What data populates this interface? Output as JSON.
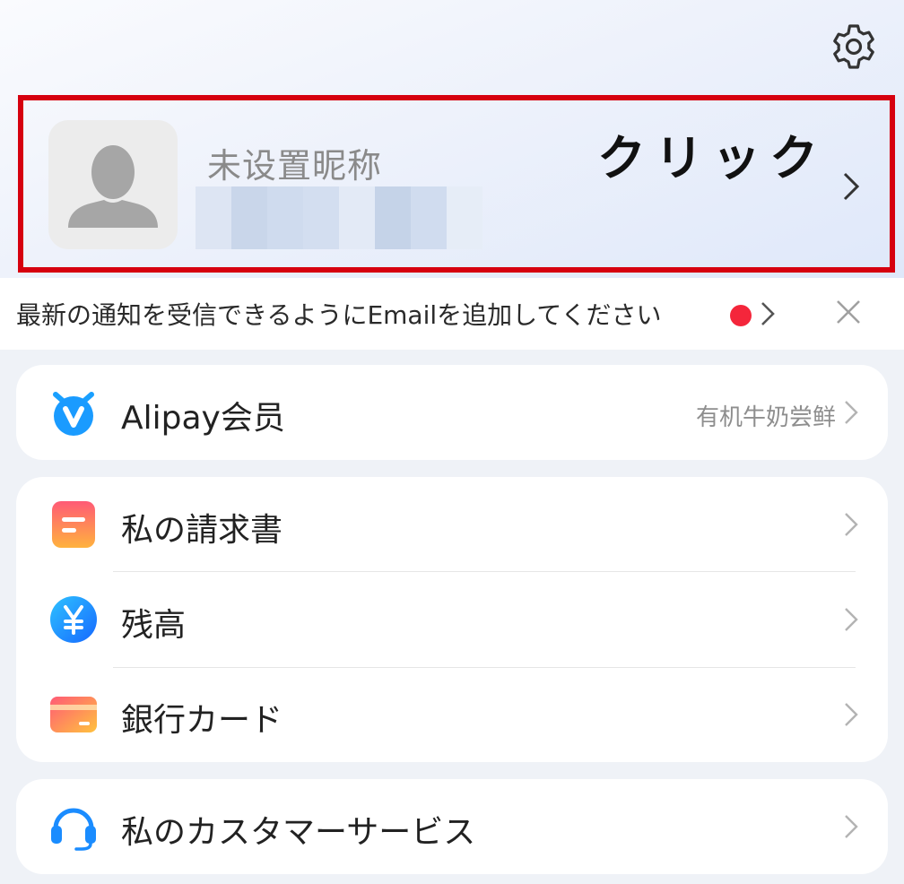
{
  "header": {
    "settings_icon": "gear-icon"
  },
  "profile": {
    "nickname": "未设置昵称",
    "annotation": "クリック",
    "avatar_icon": "user-silhouette-icon",
    "chevron_icon": "chevron-right-icon",
    "highlight_color": "#d6000f"
  },
  "notice": {
    "text": "最新の通知を受信できるようにEmailを追加してください",
    "dot_color": "#f4263b",
    "close_icon": "close-icon"
  },
  "membership": {
    "label": "Alipay会员",
    "sub": "有机牛奶尝鲜",
    "icon": "alipay-member-icon"
  },
  "finance": {
    "items": [
      {
        "label": "私の請求書",
        "icon": "bill-icon"
      },
      {
        "label": "残高",
        "icon": "yen-balance-icon"
      },
      {
        "label": "銀行カード",
        "icon": "bank-card-icon"
      }
    ]
  },
  "service": {
    "label": "私のカスタマーサービス",
    "icon": "headset-icon"
  },
  "colors": {
    "accent_blue": "#1677ff",
    "alert_red": "#f4263b"
  }
}
